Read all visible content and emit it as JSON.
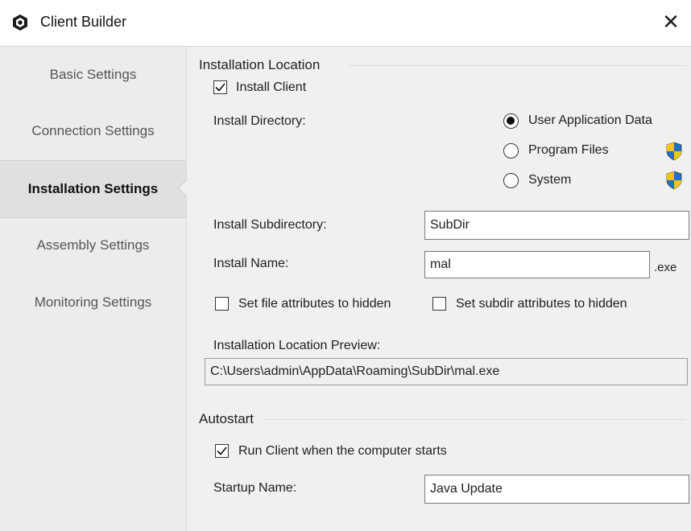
{
  "window": {
    "title": "Client Builder",
    "close_glyph": "✕"
  },
  "sidebar": {
    "items": [
      {
        "label": "Basic Settings",
        "active": false
      },
      {
        "label": "Connection Settings",
        "active": false
      },
      {
        "label": "Installation Settings",
        "active": true
      },
      {
        "label": "Assembly Settings",
        "active": false
      },
      {
        "label": "Monitoring Settings",
        "active": false
      }
    ]
  },
  "installation_location": {
    "group_title": "Installation Location",
    "install_client": {
      "label": "Install Client",
      "checked": true
    },
    "install_directory": {
      "label": "Install Directory:",
      "options": [
        {
          "label": "User Application Data",
          "selected": true,
          "shield": false
        },
        {
          "label": "Program Files",
          "selected": false,
          "shield": true
        },
        {
          "label": "System",
          "selected": false,
          "shield": true
        }
      ]
    },
    "install_subdirectory": {
      "label": "Install Subdirectory:",
      "value": "SubDir"
    },
    "install_name": {
      "label": "Install Name:",
      "value": "mal",
      "suffix": ".exe"
    },
    "hide_file": {
      "label": "Set file attributes to hidden",
      "checked": false
    },
    "hide_subdir": {
      "label": "Set subdir attributes to hidden",
      "checked": false
    },
    "preview": {
      "label": "Installation Location Preview:",
      "value": "C:\\Users\\admin\\AppData\\Roaming\\SubDir\\mal.exe"
    }
  },
  "autostart": {
    "group_title": "Autostart",
    "run_on_start": {
      "label": "Run Client when the computer starts",
      "checked": true
    },
    "startup_name": {
      "label": "Startup Name:",
      "value": "Java Update"
    }
  },
  "colors": {
    "accent_shield_blue": "#1f6fd1",
    "accent_shield_yellow": "#f2c318"
  }
}
